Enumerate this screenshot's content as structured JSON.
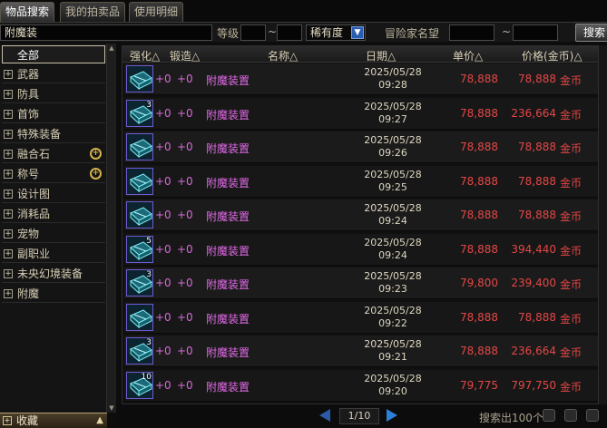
{
  "tabs": [
    "物品搜索",
    "我的拍卖品",
    "使用明细"
  ],
  "search": {
    "item_value": "附魔装",
    "level_label": "等级",
    "level_sep": "~",
    "rarity_value": "稀有度",
    "adventurer_label": "冒险家名望",
    "adv_sep": "~",
    "search_button": "搜索"
  },
  "sidebar": {
    "all_label": "全部",
    "items": [
      {
        "label": "武器",
        "mag": false
      },
      {
        "label": "防具",
        "mag": false
      },
      {
        "label": "首饰",
        "mag": false
      },
      {
        "label": "特殊装备",
        "mag": false
      },
      {
        "label": "融合石",
        "mag": true
      },
      {
        "label": "称号",
        "mag": true
      },
      {
        "label": "设计图",
        "mag": false
      },
      {
        "label": "消耗品",
        "mag": false
      },
      {
        "label": "宠物",
        "mag": false
      },
      {
        "label": "副职业",
        "mag": false
      },
      {
        "label": "未央幻境装备",
        "mag": false
      },
      {
        "label": "附魔",
        "mag": false
      }
    ],
    "favorites": "收藏"
  },
  "table": {
    "headers": {
      "strengthen": "强化△",
      "forge": "锻造△",
      "name": "名称△",
      "date": "日期△",
      "unit_price": "单价△",
      "total_price": "价格(金币)△"
    },
    "currency": "金币",
    "rows": [
      {
        "qty": "",
        "strengthen": "+0",
        "forge": "+0",
        "name": "附魔装置",
        "date": "2025/05/28",
        "time": "09:28",
        "unit_price": "78,888",
        "total_price": "78,888"
      },
      {
        "qty": "3",
        "strengthen": "+0",
        "forge": "+0",
        "name": "附魔装置",
        "date": "2025/05/28",
        "time": "09:27",
        "unit_price": "78,888",
        "total_price": "236,664"
      },
      {
        "qty": "",
        "strengthen": "+0",
        "forge": "+0",
        "name": "附魔装置",
        "date": "2025/05/28",
        "time": "09:26",
        "unit_price": "78,888",
        "total_price": "78,888"
      },
      {
        "qty": "",
        "strengthen": "+0",
        "forge": "+0",
        "name": "附魔装置",
        "date": "2025/05/28",
        "time": "09:25",
        "unit_price": "78,888",
        "total_price": "78,888"
      },
      {
        "qty": "",
        "strengthen": "+0",
        "forge": "+0",
        "name": "附魔装置",
        "date": "2025/05/28",
        "time": "09:24",
        "unit_price": "78,888",
        "total_price": "78,888"
      },
      {
        "qty": "5",
        "strengthen": "+0",
        "forge": "+0",
        "name": "附魔装置",
        "date": "2025/05/28",
        "time": "09:24",
        "unit_price": "78,888",
        "total_price": "394,440"
      },
      {
        "qty": "3",
        "strengthen": "+0",
        "forge": "+0",
        "name": "附魔装置",
        "date": "2025/05/28",
        "time": "09:23",
        "unit_price": "79,800",
        "total_price": "239,400"
      },
      {
        "qty": "",
        "strengthen": "+0",
        "forge": "+0",
        "name": "附魔装置",
        "date": "2025/05/28",
        "time": "09:22",
        "unit_price": "78,888",
        "total_price": "78,888"
      },
      {
        "qty": "3",
        "strengthen": "+0",
        "forge": "+0",
        "name": "附魔装置",
        "date": "2025/05/28",
        "time": "09:21",
        "unit_price": "78,888",
        "total_price": "236,664"
      },
      {
        "qty": "10",
        "strengthen": "+0",
        "forge": "+0",
        "name": "附魔装置",
        "date": "2025/05/28",
        "time": "09:20",
        "unit_price": "79,775",
        "total_price": "797,750"
      }
    ]
  },
  "pagination": {
    "current": "1/10"
  },
  "result_text": "搜索出100个",
  "colors": {
    "price": "#e54646",
    "name": "#e26ae8",
    "accent_blue": "#2c80d8"
  }
}
